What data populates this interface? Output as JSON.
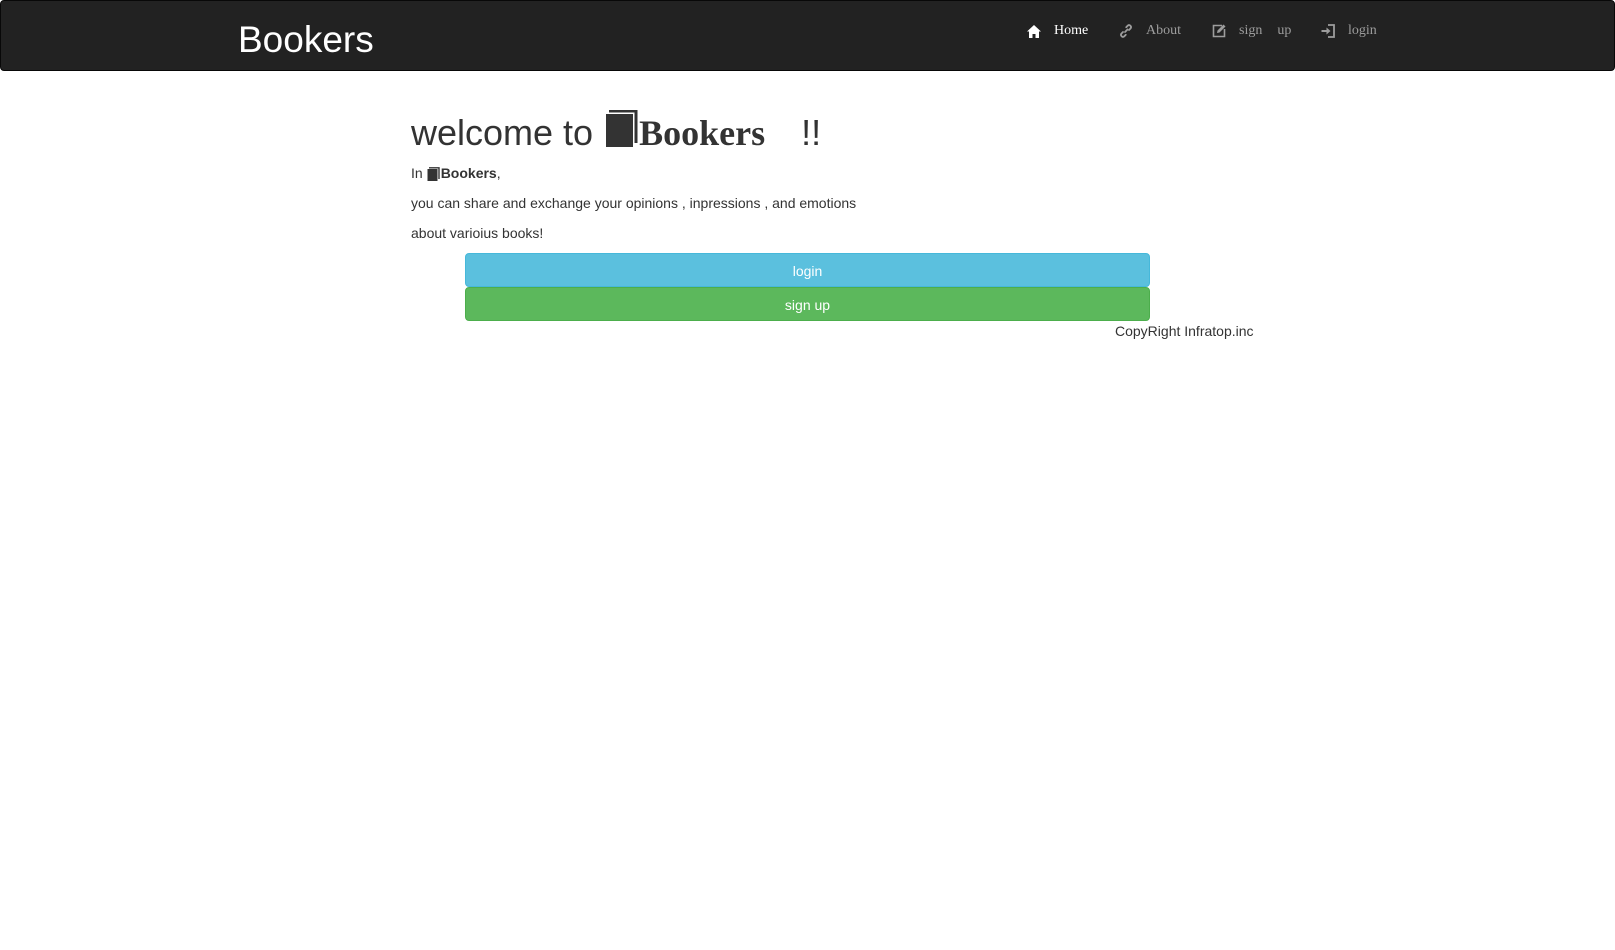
{
  "navbar": {
    "brand": "Bookers",
    "items": [
      {
        "label": "Home",
        "icon": "home-icon",
        "active": true
      },
      {
        "label": "About",
        "icon": "link-icon",
        "active": false
      },
      {
        "label_parts": [
          "sign",
          "up"
        ],
        "icon": "edit-icon",
        "active": false
      },
      {
        "label": "login",
        "icon": "log-in-icon",
        "active": false
      }
    ]
  },
  "main": {
    "headline": {
      "prefix": "welcome to",
      "icon": "book-icon",
      "brand": "Bookers",
      "suffix": "!!"
    },
    "intro": {
      "in_text": "In",
      "brand": "Bookers",
      "comma": ",",
      "line2": "you can share and exchange your opinions , inpressions , and emotions",
      "line3": "about varioius books!"
    },
    "buttons": {
      "login_label": "login",
      "signup_label": "sign up"
    },
    "footer": {
      "copyright": "CopyRight Infratop.inc"
    }
  },
  "colors": {
    "navbar_bg": "#222222",
    "nav_text": "#9d9d9d",
    "nav_active_text": "#ffffff",
    "login_button": "#5bc0de",
    "signup_button": "#5cb85c",
    "body_text": "#333333"
  }
}
